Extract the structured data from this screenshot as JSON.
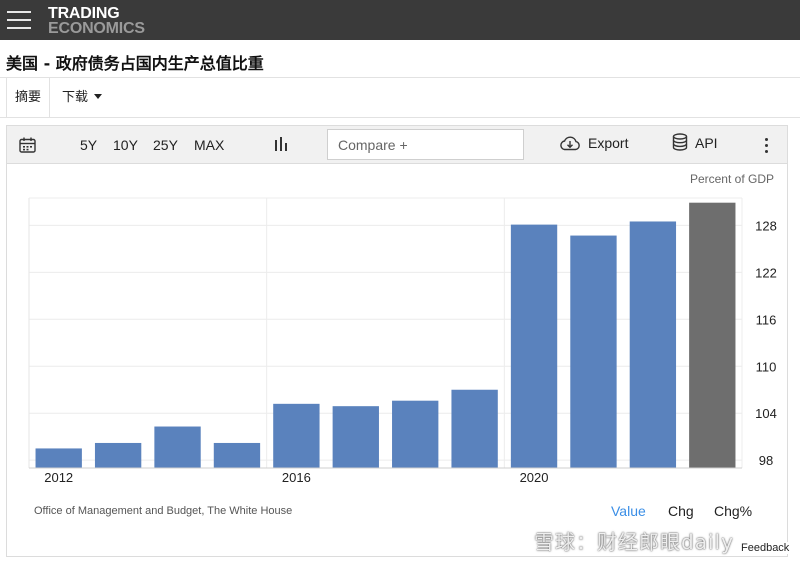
{
  "header": {
    "logo_line1": "TRADING",
    "logo_line2": "ECONOMICS"
  },
  "page": {
    "title": "美国 - 政府债务占国内生产总值比重"
  },
  "tabs": {
    "summary": "摘要",
    "download": "下载"
  },
  "toolbar": {
    "ranges": [
      "5Y",
      "10Y",
      "25Y",
      "MAX"
    ],
    "compare_placeholder": "Compare +",
    "export_label": "Export",
    "api_label": "API"
  },
  "chart_data": {
    "type": "bar",
    "unit_label": "Percent of GDP",
    "categories": [
      "2012",
      "2013",
      "2014",
      "2015",
      "2016",
      "2017",
      "2018",
      "2019",
      "2020",
      "2021",
      "2022",
      "2023"
    ],
    "x_tick_labels": [
      {
        "index": 0,
        "label": "2012"
      },
      {
        "index": 4,
        "label": "2016"
      },
      {
        "index": 8,
        "label": "2020"
      }
    ],
    "values": [
      99.5,
      100.2,
      102.3,
      100.2,
      105.2,
      104.9,
      105.6,
      107.0,
      128.1,
      126.7,
      128.5,
      130.9
    ],
    "bar_colors": [
      "#5a82bd",
      "#5a82bd",
      "#5a82bd",
      "#5a82bd",
      "#5a82bd",
      "#5a82bd",
      "#5a82bd",
      "#5a82bd",
      "#5a82bd",
      "#5a82bd",
      "#5a82bd",
      "#6e6e6e"
    ],
    "ylim": [
      97,
      131.5
    ],
    "y_ticks": [
      98,
      104,
      110,
      116,
      122,
      128
    ],
    "grid": true,
    "axis_position": "right"
  },
  "footer": {
    "source": "Office of Management and Budget, The White House",
    "modes": [
      "Value",
      "Chg",
      "Chg%"
    ],
    "active_mode": "Value",
    "active_color": "#3a8ee6"
  },
  "watermark": "雪球：财经郎眼daily",
  "feedback_label": "Feedback"
}
